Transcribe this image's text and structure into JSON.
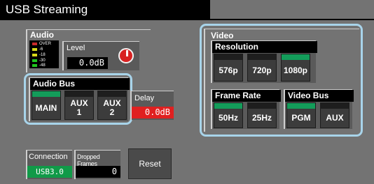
{
  "title": "USB Streaming",
  "audio": {
    "header": "Audio",
    "meter_labels": [
      "OVER",
      "-6",
      "-18",
      "-30",
      "-48"
    ],
    "level_label": "Level",
    "level_value": "0.0dB"
  },
  "audio_bus": {
    "header": "Audio Bus",
    "buttons": [
      {
        "label": "MAIN",
        "active": true
      },
      {
        "label": "AUX\n1",
        "active": false
      },
      {
        "label": "AUX\n2",
        "active": false
      }
    ]
  },
  "delay": {
    "label": "Delay",
    "value": "0.0dB"
  },
  "video": {
    "header": "Video",
    "resolution": {
      "header": "Resolution",
      "options": [
        {
          "label": "576p",
          "active": false
        },
        {
          "label": "720p",
          "active": false
        },
        {
          "label": "1080p",
          "active": true
        }
      ]
    },
    "frame_rate": {
      "header": "Frame Rate",
      "options": [
        {
          "label": "50Hz",
          "active": true
        },
        {
          "label": "25Hz",
          "active": false
        }
      ]
    },
    "video_bus": {
      "header": "Video Bus",
      "options": [
        {
          "label": "PGM",
          "active": true
        },
        {
          "label": "AUX",
          "active": false
        }
      ]
    }
  },
  "connection": {
    "label": "Connection",
    "value": "USB3.0"
  },
  "dropped_frames": {
    "label": "Dropped Frames",
    "value": "0"
  },
  "reset_label": "Reset",
  "colors": {
    "background": "#737373",
    "active_led": "#139c5a",
    "highlight": "#a8d4ea",
    "delay_red": "#e02020",
    "connection_green": "#109a48"
  },
  "icons": [
    "level-knob-icon",
    "level-meter-icon"
  ]
}
